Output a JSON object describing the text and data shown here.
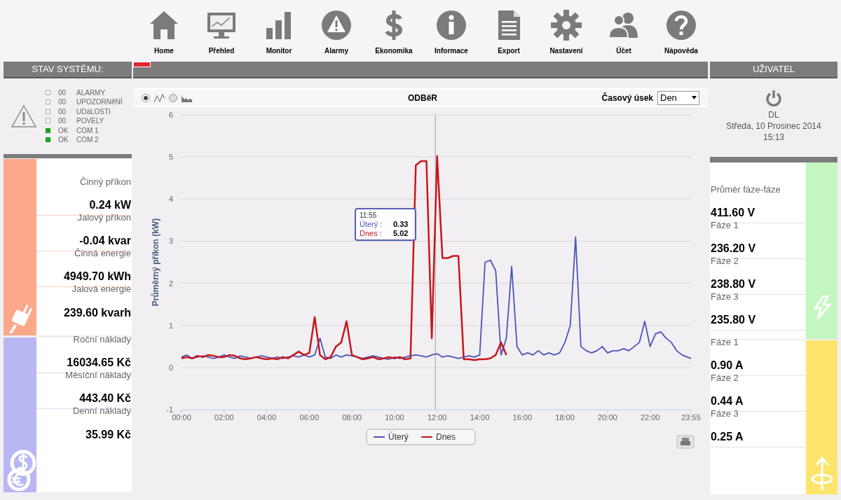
{
  "nav": [
    {
      "label": "Home"
    },
    {
      "label": "Přehled"
    },
    {
      "label": "Monitor"
    },
    {
      "label": "Alarmy"
    },
    {
      "label": "Ekonomika"
    },
    {
      "label": "Informace"
    },
    {
      "label": "Export"
    },
    {
      "label": "Nastavení"
    },
    {
      "label": "Účet"
    },
    {
      "label": "Nápověda"
    }
  ],
  "status": {
    "title": "STAV SYSTÉMU:",
    "rows": [
      {
        "count": "00",
        "label": "ALARMY",
        "ok": false
      },
      {
        "count": "00",
        "label": "UPOZORNěNÍ",
        "ok": false
      },
      {
        "count": "00",
        "label": "UDáLOSTI",
        "ok": false
      },
      {
        "count": "00",
        "label": "POVELY",
        "ok": false
      },
      {
        "count": "OK",
        "label": "COM 1",
        "ok": true
      },
      {
        "count": "OK",
        "label": "COM 2",
        "ok": true
      }
    ]
  },
  "power": {
    "items": [
      {
        "label": "Činný příkon",
        "value": "0.24 kW"
      },
      {
        "label": "Jalový příkon",
        "value": "-0.04 kvar"
      },
      {
        "label": "Činná energie",
        "value": "4949.70 kWh"
      },
      {
        "label": "Jalová energie",
        "value": "239.60 kvarh"
      }
    ]
  },
  "costs": {
    "items": [
      {
        "label": "Roční náklady",
        "value": "16034.65 Kč"
      },
      {
        "label": "Měsíční náklady",
        "value": "443.40 Kč"
      },
      {
        "label": "Denní náklady",
        "value": "35.99 Kč"
      }
    ]
  },
  "chart": {
    "modes": [
      {
        "selected": true
      },
      {
        "selected": false
      }
    ],
    "period_label": "Časový úsek",
    "period": "Den",
    "chart_data": {
      "type": "line",
      "title": "ODBěR",
      "ylabel": "Průměrný příkon (kW)",
      "x": [
        0,
        0.25,
        0.5,
        0.75,
        1,
        1.25,
        1.5,
        1.75,
        2,
        2.25,
        2.5,
        2.75,
        3,
        3.25,
        3.5,
        3.75,
        4,
        4.25,
        4.5,
        4.75,
        5,
        5.25,
        5.5,
        5.75,
        6,
        6.25,
        6.5,
        6.75,
        7,
        7.25,
        7.5,
        7.75,
        8,
        8.25,
        8.5,
        8.75,
        9,
        9.25,
        9.5,
        9.75,
        10,
        10.25,
        10.5,
        10.75,
        11,
        11.25,
        11.5,
        11.75,
        12,
        12.25,
        12.5,
        12.75,
        13,
        13.25,
        13.5,
        13.75,
        14,
        14.25,
        14.5,
        14.75,
        15,
        15.25,
        15.5,
        15.75,
        16,
        16.25,
        16.5,
        16.75,
        17,
        17.25,
        17.5,
        17.75,
        18,
        18.25,
        18.5,
        18.75,
        19,
        19.25,
        19.5,
        19.75,
        20,
        20.25,
        20.5,
        20.75,
        21,
        21.25,
        21.5,
        21.75,
        22,
        22.25,
        22.5,
        22.75,
        23,
        23.25,
        23.5,
        23.75,
        23.92
      ],
      "series": [
        {
          "name": "Úterý",
          "color": "#4a55b8",
          "values": [
            0.25,
            0.3,
            0.22,
            0.25,
            0.28,
            0.25,
            0.22,
            0.25,
            0.3,
            0.25,
            0.22,
            0.28,
            0.25,
            0.22,
            0.25,
            0.28,
            0.25,
            0.22,
            0.25,
            0.22,
            0.25,
            0.28,
            0.25,
            0.3,
            0.25,
            0.3,
            0.7,
            0.25,
            0.22,
            0.3,
            0.25,
            0.3,
            0.28,
            0.25,
            0.22,
            0.25,
            0.28,
            0.25,
            0.22,
            0.2,
            0.25,
            0.22,
            0.25,
            0.28,
            0.3,
            0.28,
            0.25,
            0.3,
            0.33,
            0.25,
            0.28,
            0.25,
            0.22,
            0.25,
            0.28,
            0.25,
            0.3,
            2.5,
            2.55,
            2.3,
            0.3,
            0.7,
            2.4,
            0.5,
            0.3,
            0.35,
            0.3,
            0.4,
            0.3,
            0.35,
            0.3,
            0.35,
            0.6,
            1.0,
            3.1,
            0.5,
            0.4,
            0.35,
            0.4,
            0.5,
            0.35,
            0.4,
            0.4,
            0.45,
            0.4,
            0.5,
            0.6,
            1.1,
            0.5,
            0.8,
            0.85,
            0.7,
            0.6,
            0.4,
            0.3,
            0.25,
            0.22
          ]
        },
        {
          "name": "Dnes",
          "color": "#c8161d",
          "values": [
            0.22,
            0.25,
            0.22,
            0.28,
            0.25,
            0.3,
            0.28,
            0.25,
            0.25,
            0.3,
            0.28,
            0.22,
            0.2,
            0.22,
            0.25,
            0.22,
            0.2,
            0.22,
            0.2,
            0.25,
            0.22,
            0.3,
            0.38,
            0.3,
            0.35,
            1.2,
            0.3,
            0.2,
            0.25,
            0.5,
            0.6,
            1.1,
            0.3,
            0.25,
            0.2,
            0.22,
            0.25,
            0.2,
            0.22,
            0.25,
            0.22,
            0.25,
            0.2,
            0.22,
            4.8,
            4.9,
            4.9,
            0.7,
            5.02,
            2.6,
            2.6,
            2.65,
            2.65,
            0.2,
            0.2,
            0.18,
            0.2,
            0.2,
            0.22,
            0.3,
            0.6,
            0.3,
            null,
            null,
            null,
            null,
            null,
            null,
            null,
            null,
            null,
            null,
            null,
            null,
            null,
            null,
            null,
            null,
            null,
            null,
            null,
            null,
            null,
            null,
            null,
            null,
            null,
            null,
            null,
            null,
            null,
            null,
            null,
            null,
            null,
            null,
            null
          ]
        }
      ],
      "grid": true,
      "legend": true,
      "ref_lines": [
        {
          "axis": "x",
          "value": 11.92
        }
      ],
      "xlim": [
        0,
        23.92
      ],
      "ylim": [
        -1,
        6
      ],
      "yticks": [
        -1,
        0,
        1,
        2,
        3,
        4,
        5,
        6
      ],
      "xticks": [
        {
          "value": 0,
          "label": "00:00"
        },
        {
          "value": 2,
          "label": "02:00"
        },
        {
          "value": 4,
          "label": "04:00"
        },
        {
          "value": 6,
          "label": "06:00"
        },
        {
          "value": 8,
          "label": "08:00"
        },
        {
          "value": 10,
          "label": "10:00"
        },
        {
          "value": 12,
          "label": "12:00"
        },
        {
          "value": 14,
          "label": "14:00"
        },
        {
          "value": 16,
          "label": "16:00"
        },
        {
          "value": 18,
          "label": "18:00"
        },
        {
          "value": 20,
          "label": "20:00"
        },
        {
          "value": 22,
          "label": "22:00"
        },
        {
          "value": 23.92,
          "label": "23:55"
        }
      ]
    },
    "tooltip": {
      "time": "11:55",
      "rows": [
        {
          "name": "Úterý :",
          "value": "0.33"
        },
        {
          "name": "Dnes :",
          "value": "5.02"
        }
      ]
    }
  },
  "user": {
    "title": "UŽIVATEL",
    "name": "DL",
    "date": "Středa, 10 Prosinec 2014",
    "time": "15:13"
  },
  "voltage": {
    "items": [
      {
        "label": "Průměr fáze-fáze",
        "value": "411.60 V"
      },
      {
        "label": "Fáze 1",
        "value": "236.20 V"
      },
      {
        "label": "Fáze 2",
        "value": "238.80 V"
      },
      {
        "label": "Fáze 3",
        "value": "235.80 V"
      }
    ]
  },
  "current": {
    "items": [
      {
        "label": "Fáze 1",
        "value": "0.90 A"
      },
      {
        "label": "Fáze 2",
        "value": "0.44 A"
      },
      {
        "label": "Fáze 3",
        "value": "0.25 A"
      }
    ]
  }
}
